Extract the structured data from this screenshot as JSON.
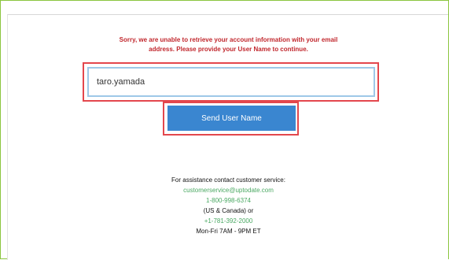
{
  "message": {
    "line1": "Sorry, we are unable to retrieve your account information with your email",
    "line2": "address. Please provide your User Name to continue."
  },
  "username_field": {
    "value": "taro.yamada",
    "placeholder": ""
  },
  "send_button": {
    "label": "Send User Name"
  },
  "assistance": {
    "heading": "For assistance contact customer service:",
    "email": "customerservice@uptodate.com",
    "phone_us": "1-800-998-6374",
    "region_note": "(US & Canada) or",
    "phone_intl": "+1-781-392-2000",
    "hours": "Mon-Fri 7AM - 9PM ET"
  },
  "colors": {
    "error_text": "#c1272d",
    "highlight_border": "#e3474d",
    "button": "#3a86d0",
    "link": "#4aa862",
    "frame": "#8bc53f"
  }
}
